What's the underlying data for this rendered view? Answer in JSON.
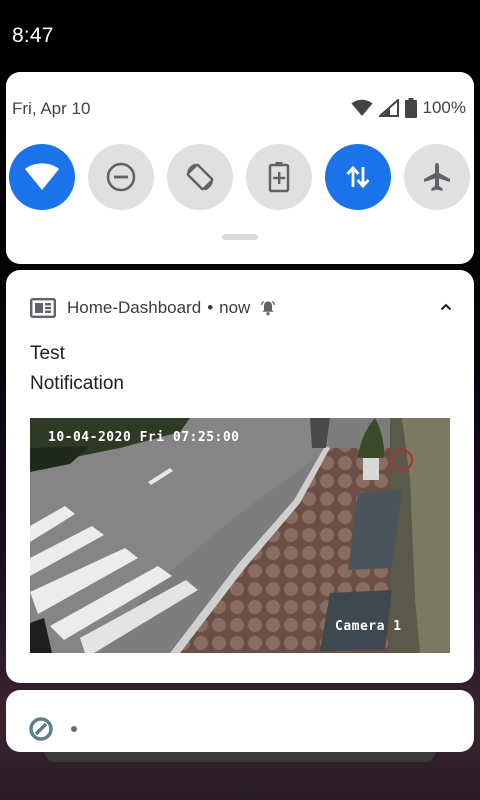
{
  "status_bar": {
    "time": "8:47"
  },
  "quick_settings": {
    "date": "Fri, Apr 10",
    "battery_percent": "100%",
    "tiles": [
      {
        "name": "wifi",
        "icon": "wifi-icon",
        "active": true
      },
      {
        "name": "do-not-disturb",
        "icon": "do-not-disturb-icon",
        "active": false
      },
      {
        "name": "auto-rotate",
        "icon": "auto-rotate-icon",
        "active": false
      },
      {
        "name": "battery-saver",
        "icon": "battery-saver-icon",
        "active": false
      },
      {
        "name": "mobile-data",
        "icon": "mobile-data-icon",
        "active": true
      },
      {
        "name": "airplane-mode",
        "icon": "airplane-icon",
        "active": false
      }
    ]
  },
  "notification": {
    "app_name": "Home-Dashboard",
    "separator": "•",
    "time": "now",
    "title": "Test",
    "text": "Notification",
    "image": {
      "timestamp": "10-04-2020 Fri 07:25:00",
      "camera_label": "Camera 1"
    }
  },
  "notification_2": {
    "dot": "•"
  },
  "colors": {
    "accent": "#1a73e8",
    "tile_off": "#e0e0e0",
    "panel": "#ffffff"
  }
}
